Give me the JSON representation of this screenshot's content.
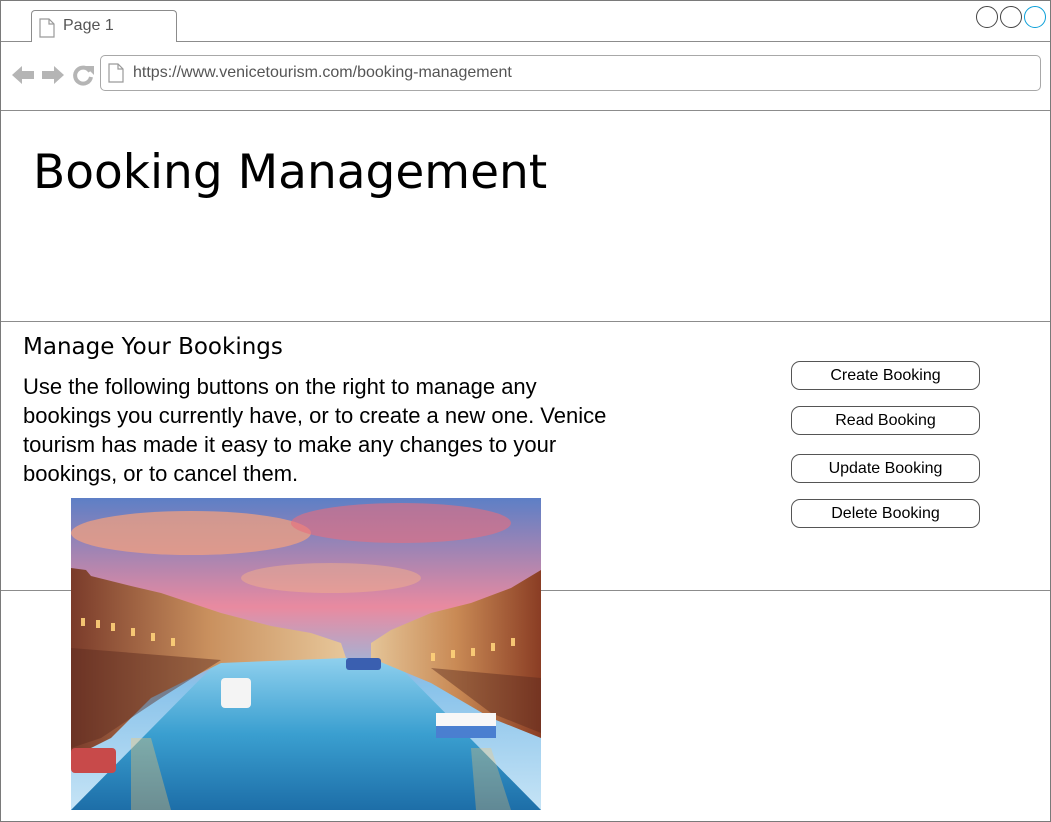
{
  "browser": {
    "tab_label": "Page 1",
    "url": "https://www.venicetourism.com/booking-management",
    "accent_color": "#0a9fd8"
  },
  "page": {
    "title": "Booking Management"
  },
  "manage": {
    "heading": "Manage Your Bookings",
    "description": "Use the following buttons on the right to manage any bookings you currently have, or to create a new one. Venice tourism has made it easy to make any changes to your bookings, or to cancel them."
  },
  "actions": {
    "create_label": "Create Booking",
    "read_label": "Read Booking",
    "update_label": "Update Booking",
    "delete_label": "Delete Booking"
  },
  "image": {
    "subject": "Venice Grand Canal at sunset"
  },
  "icons": {
    "back": "arrow-left-icon",
    "forward": "arrow-right-icon",
    "reload": "reload-icon",
    "page": "page-icon"
  }
}
